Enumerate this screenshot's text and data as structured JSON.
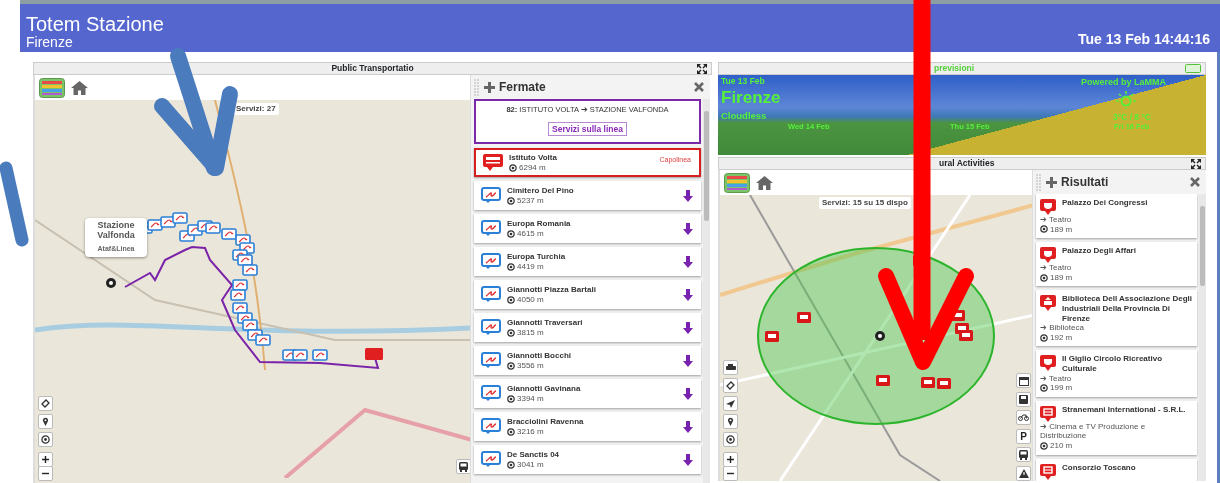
{
  "header": {
    "title": "Totem Stazione",
    "city": "Firenze",
    "datetime": "Tue 13 Feb 14:44:16"
  },
  "transport": {
    "title": "Public Transportatio",
    "map": {
      "services_label": "Servizi: 27",
      "popup": {
        "title": "Stazione Valfonda",
        "subtitle": "Ataf&Linea"
      }
    },
    "stops_panel": {
      "title": "Fermate",
      "line": {
        "label": "**82:** ISTITUTO VOLTA ➔ STAZIONE VALFONDA",
        "button": "Servizi sulla linea"
      },
      "stops": [
        {
          "kind": "terminus",
          "name": "Istituto Volta",
          "distance": "6294 m",
          "tag": "Capolinea"
        },
        {
          "kind": "stop",
          "name": "Cimitero Del Pino",
          "distance": "5237 m"
        },
        {
          "kind": "stop",
          "name": "Europa Romania",
          "distance": "4615 m"
        },
        {
          "kind": "stop",
          "name": "Europa Turchia",
          "distance": "4419 m"
        },
        {
          "kind": "stop",
          "name": "Giannotti Piazza Bartali",
          "distance": "4050 m"
        },
        {
          "kind": "stop",
          "name": "Giannotti Traversari",
          "distance": "3815 m"
        },
        {
          "kind": "stop",
          "name": "Giannotti Bocchi",
          "distance": "3556 m"
        },
        {
          "kind": "stop",
          "name": "Giannotti Gavinana",
          "distance": "3394 m"
        },
        {
          "kind": "stop",
          "name": "Bracciolini Ravenna",
          "distance": "3216 m"
        },
        {
          "kind": "stop",
          "name": "De Sanctis 04",
          "distance": "3041 m"
        }
      ]
    }
  },
  "weather": {
    "title": "previsioni",
    "today": {
      "date": "Tue 13 Feb",
      "city": "Firenze",
      "sky": "Cloudless",
      "temps": "3°C / 8 °C"
    },
    "credit": "Powered by LaMMA",
    "days": [
      {
        "date": "Wed 14 Feb"
      },
      {
        "date": "Thu 15 Feb"
      },
      {
        "date": "Fri 16 Feb"
      }
    ]
  },
  "culture": {
    "title": "ural Activities",
    "map": {
      "services_label": "Servizi: 15 su 15 dispo",
      "tools": [
        {
          "kind": "calendar"
        },
        {
          "kind": "save"
        },
        {
          "kind": "bike"
        },
        {
          "kind": "parking",
          "label": "P"
        },
        {
          "kind": "bus"
        },
        {
          "kind": "warning"
        }
      ]
    },
    "results_panel": {
      "title": "Risultati",
      "results": [
        {
          "kind": "theatre",
          "name": "Palazzo Dei Congressi",
          "category": "➔ Teatro",
          "distance": "189 m"
        },
        {
          "kind": "theatre",
          "name": "Palazzo Degli Affari",
          "category": "➔ Teatro",
          "distance": "189 m"
        },
        {
          "kind": "library",
          "name": "Biblioteca Dell Associazione Degli Industriali Della Provincia Di Firenze",
          "category": "➔ Biblioteca",
          "distance": "192 m"
        },
        {
          "kind": "theatre",
          "name": "Il Giglio Circolo Ricreativo Culturale",
          "category": "➔ Teatro",
          "distance": "199 m"
        },
        {
          "kind": "cinema",
          "name": "Stranemani International - S.R.L.",
          "category": "➔ Cinema e TV Produzione e Distribuzione",
          "distance": "210 m"
        },
        {
          "kind": "cinema",
          "name": "Consorzio Toscano"
        }
      ]
    }
  }
}
